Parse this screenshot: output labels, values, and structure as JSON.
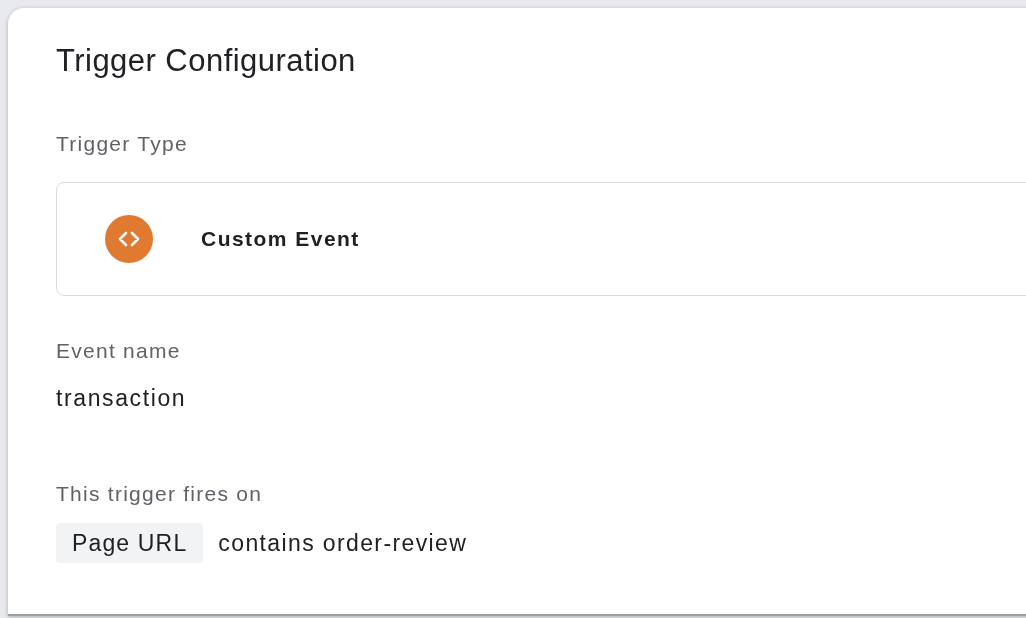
{
  "panel": {
    "title": "Trigger Configuration"
  },
  "trigger_type": {
    "label": "Trigger Type",
    "type_name": "Custom Event"
  },
  "event_name": {
    "label": "Event name",
    "value": "transaction"
  },
  "fires_on": {
    "label": "This trigger fires on",
    "conditions": [
      {
        "variable": "Page URL",
        "text": "contains order-review"
      }
    ]
  }
}
